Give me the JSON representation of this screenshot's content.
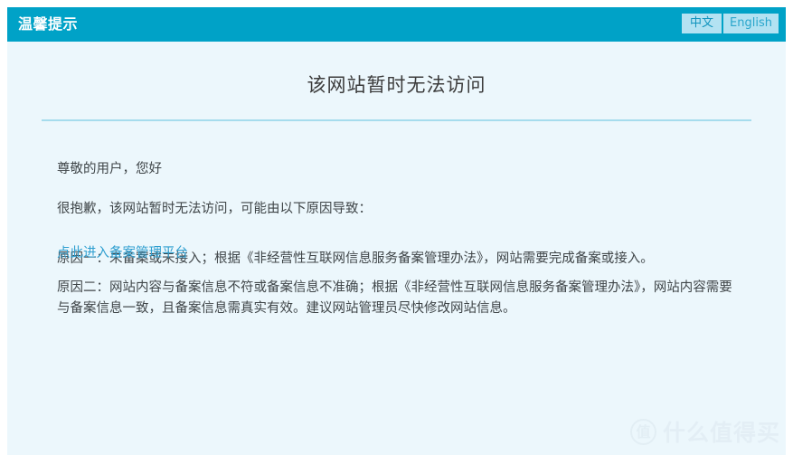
{
  "header": {
    "title": "温馨提示",
    "languages": [
      {
        "label": "中文",
        "code": "zh",
        "active": true
      },
      {
        "label": "English",
        "code": "en",
        "active": false
      }
    ]
  },
  "main": {
    "page_title": "该网站暂时无法访问",
    "greeting": "尊敬的用户，您好",
    "intro": "很抱歉，该网站暂时无法访问，可能由以下原因导致：",
    "reason_one": "原因一：未备案或未接入；根据《非经营性互联网信息服务备案管理办法》，网站需要完成备案或接入。",
    "reason_two": "原因二：网站内容与备案信息不符或备案信息不准确；根据《非经营性互联网信息服务备案管理办法》，网站内容需要与备案信息一致，且备案信息需真实有效。建议网站管理员尽快修改网站信息。",
    "portal_link": "点此进入备案管理平台"
  },
  "watermark": {
    "badge": "值",
    "text": "什么值得买"
  },
  "colors": {
    "header_bg": "#00a2c7",
    "page_bg": "#ecf7fc",
    "divider": "#a6dced",
    "link": "#2f9fd0",
    "lang_bg": "#b3e2f2",
    "body_text": "#3f4548"
  }
}
